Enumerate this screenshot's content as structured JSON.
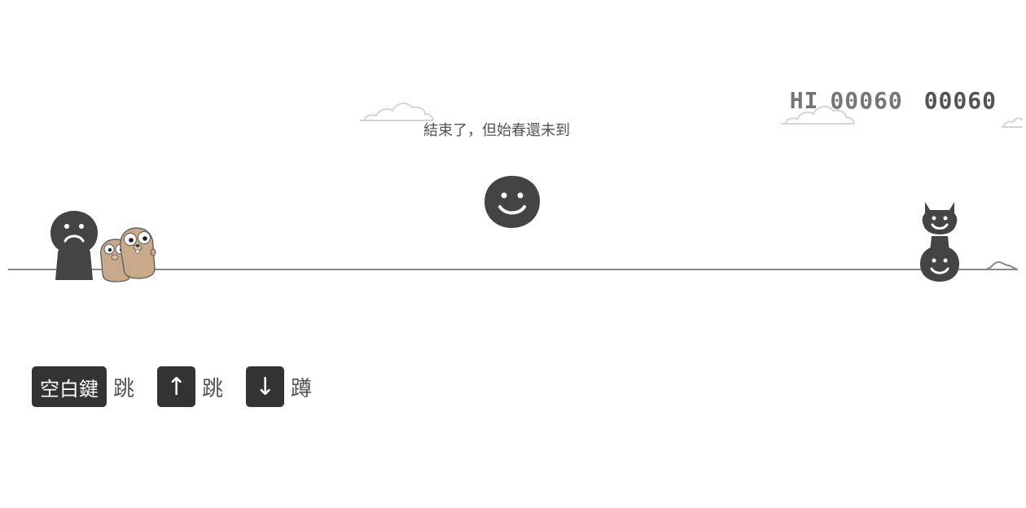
{
  "score": {
    "hi_label": "HI",
    "hi_value": "00060",
    "current": "00060"
  },
  "game_over_text": "結束了，但始春還未到",
  "controls": [
    {
      "key": "空白鍵",
      "action": "跳"
    },
    {
      "key": "↑",
      "action": "跳"
    },
    {
      "key": "↓",
      "action": "蹲"
    }
  ],
  "colors": {
    "ink": "#535353",
    "dark": "#444444",
    "key_bg": "#333333",
    "gopher": "#c8a98a",
    "ground": "#8a8a8a"
  },
  "icons": {
    "player": "sad-face-character",
    "companion": "gopher-mascots",
    "enemy_flying": "smiley-face",
    "enemy_ground": "stacked-devil-smiley"
  }
}
